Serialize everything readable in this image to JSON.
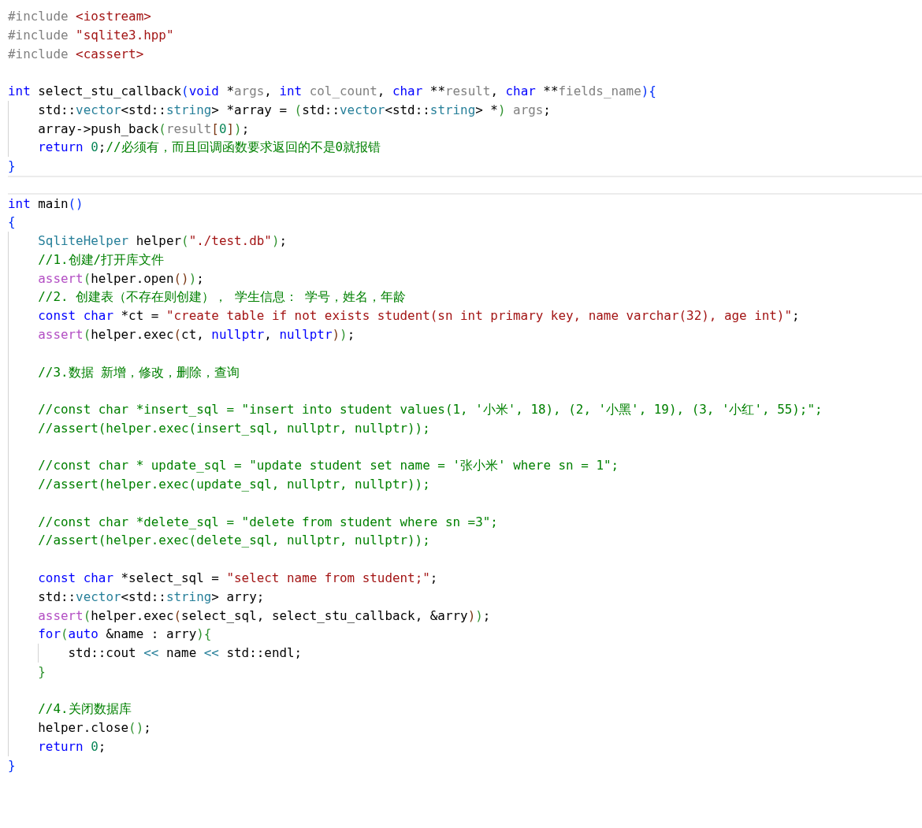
{
  "editor": {
    "lines": [
      {
        "selected": false,
        "tokens": [
          {
            "kind": "pp",
            "text": "#include"
          },
          {
            "kind": "str",
            "text": " <iostream>"
          }
        ]
      },
      {
        "selected": false,
        "tokens": [
          {
            "kind": "pp",
            "text": "#include"
          },
          {
            "kind": "str",
            "text": " \"sqlite3.hpp\""
          }
        ]
      },
      {
        "selected": false,
        "tokens": [
          {
            "kind": "pp",
            "text": "#include"
          },
          {
            "kind": "str",
            "text": " <cassert>"
          }
        ]
      },
      {
        "selected": false
      },
      {
        "selected": false,
        "tokens": [
          {
            "kind": "kw",
            "text": "int"
          },
          {
            "kind": "plain",
            "text": " select_stu_callback"
          },
          {
            "kind": "b1",
            "text": "("
          },
          {
            "kind": "kw",
            "text": "void"
          },
          {
            "kind": "plain",
            "text": " *"
          },
          {
            "kind": "param",
            "text": "args"
          },
          {
            "kind": "plain",
            "text": ", "
          },
          {
            "kind": "kw",
            "text": "int"
          },
          {
            "kind": "param",
            "text": " col_count"
          },
          {
            "kind": "plain",
            "text": ", "
          },
          {
            "kind": "kw",
            "text": "char"
          },
          {
            "kind": "plain",
            "text": " **"
          },
          {
            "kind": "param",
            "text": "result"
          },
          {
            "kind": "plain",
            "text": ", "
          },
          {
            "kind": "kw",
            "text": "char"
          },
          {
            "kind": "plain",
            "text": " **"
          },
          {
            "kind": "param",
            "text": "fields_name"
          },
          {
            "kind": "b1",
            "text": "){"
          }
        ]
      },
      {
        "selected": false,
        "tokens": [
          {
            "kind": "plain",
            "text": "    std::"
          },
          {
            "kind": "type",
            "text": "vector"
          },
          {
            "kind": "plain",
            "text": "<std::"
          },
          {
            "kind": "type",
            "text": "string"
          },
          {
            "kind": "plain",
            "text": "> *array = "
          },
          {
            "kind": "b2",
            "text": "("
          },
          {
            "kind": "plain",
            "text": "std::"
          },
          {
            "kind": "type",
            "text": "vector"
          },
          {
            "kind": "plain",
            "text": "<std::"
          },
          {
            "kind": "type",
            "text": "string"
          },
          {
            "kind": "plain",
            "text": "> *"
          },
          {
            "kind": "b2",
            "text": ")"
          },
          {
            "kind": "param",
            "text": " args"
          },
          {
            "kind": "plain",
            "text": ";"
          }
        ]
      },
      {
        "selected": false,
        "tokens": [
          {
            "kind": "plain",
            "text": "    array->push_back"
          },
          {
            "kind": "b2",
            "text": "("
          },
          {
            "kind": "param",
            "text": "result"
          },
          {
            "kind": "b3",
            "text": "["
          },
          {
            "kind": "num",
            "text": "0"
          },
          {
            "kind": "b3",
            "text": "]"
          },
          {
            "kind": "b2",
            "text": ")"
          },
          {
            "kind": "plain",
            "text": ";"
          }
        ]
      },
      {
        "selected": false,
        "tokens": [
          {
            "kind": "kw",
            "text": "    return"
          },
          {
            "kind": "num",
            "text": " 0"
          },
          {
            "kind": "plain",
            "text": ";"
          },
          {
            "kind": "com",
            "text": "//必须有，而且回调函数要求返回的不是0就报错"
          }
        ]
      },
      {
        "selected": false,
        "tokens": [
          {
            "kind": "b1",
            "text": "}"
          }
        ]
      },
      {
        "selected": true
      },
      {
        "selected": false,
        "tokens": [
          {
            "kind": "kw",
            "text": "int"
          },
          {
            "kind": "plain",
            "text": " main"
          },
          {
            "kind": "b1",
            "text": "()"
          }
        ]
      },
      {
        "selected": false,
        "tokens": [
          {
            "kind": "b1",
            "text": "{"
          }
        ]
      },
      {
        "selected": false,
        "tokens": [
          {
            "kind": "type",
            "text": "    SqliteHelper"
          },
          {
            "kind": "plain",
            "text": " helper"
          },
          {
            "kind": "b2",
            "text": "("
          },
          {
            "kind": "str",
            "text": "\"./test.db\""
          },
          {
            "kind": "b2",
            "text": ")"
          },
          {
            "kind": "plain",
            "text": ";"
          }
        ]
      },
      {
        "selected": false,
        "tokens": [
          {
            "kind": "com",
            "text": "    //1.创建/打开库文件"
          }
        ]
      },
      {
        "selected": false,
        "tokens": [
          {
            "kind": "fn",
            "text": "    assert"
          },
          {
            "kind": "b2",
            "text": "("
          },
          {
            "kind": "plain",
            "text": "helper.open"
          },
          {
            "kind": "b3",
            "text": "()"
          },
          {
            "kind": "b2",
            "text": ")"
          },
          {
            "kind": "plain",
            "text": ";"
          }
        ]
      },
      {
        "selected": false,
        "tokens": [
          {
            "kind": "com",
            "text": "    //2. 创建表（不存在则创建）， 学生信息： 学号，姓名，年龄"
          }
        ]
      },
      {
        "selected": false,
        "tokens": [
          {
            "kind": "kw",
            "text": "    const"
          },
          {
            "kind": "kw",
            "text": " char"
          },
          {
            "kind": "plain",
            "text": " *ct = "
          },
          {
            "kind": "str",
            "text": "\"create table if not exists student(sn int primary key, name varchar(32), age int)\""
          },
          {
            "kind": "plain",
            "text": ";"
          }
        ]
      },
      {
        "selected": false,
        "tokens": [
          {
            "kind": "fn",
            "text": "    assert"
          },
          {
            "kind": "b2",
            "text": "("
          },
          {
            "kind": "plain",
            "text": "helper.exec"
          },
          {
            "kind": "b3",
            "text": "("
          },
          {
            "kind": "plain",
            "text": "ct, "
          },
          {
            "kind": "kw",
            "text": "nullptr"
          },
          {
            "kind": "plain",
            "text": ", "
          },
          {
            "kind": "kw",
            "text": "nullptr"
          },
          {
            "kind": "b3",
            "text": ")"
          },
          {
            "kind": "b2",
            "text": ")"
          },
          {
            "kind": "plain",
            "text": ";"
          }
        ]
      },
      {
        "selected": false
      },
      {
        "selected": false,
        "tokens": [
          {
            "kind": "com",
            "text": "    //3.数据 新增，修改，删除，查询"
          }
        ]
      },
      {
        "selected": false
      },
      {
        "selected": false,
        "tokens": [
          {
            "kind": "com",
            "text": "    //const char *insert_sql = \"insert into student values(1, '小米', 18), (2, '小黑', 19), (3, '小红', 55);\";"
          }
        ]
      },
      {
        "selected": false,
        "tokens": [
          {
            "kind": "com",
            "text": "    //assert(helper.exec(insert_sql, nullptr, nullptr));"
          }
        ]
      },
      {
        "selected": false
      },
      {
        "selected": false,
        "tokens": [
          {
            "kind": "com",
            "text": "    //const char * update_sql = \"update student set name = '张小米' where sn = 1\";"
          }
        ]
      },
      {
        "selected": false,
        "tokens": [
          {
            "kind": "com",
            "text": "    //assert(helper.exec(update_sql, nullptr, nullptr));"
          }
        ]
      },
      {
        "selected": false
      },
      {
        "selected": false,
        "tokens": [
          {
            "kind": "com",
            "text": "    //const char *delete_sql = \"delete from student where sn =3\";"
          }
        ]
      },
      {
        "selected": false,
        "tokens": [
          {
            "kind": "com",
            "text": "    //assert(helper.exec(delete_sql, nullptr, nullptr));"
          }
        ]
      },
      {
        "selected": false
      },
      {
        "selected": false,
        "tokens": [
          {
            "kind": "kw",
            "text": "    const"
          },
          {
            "kind": "kw",
            "text": " char"
          },
          {
            "kind": "plain",
            "text": " *select_sql = "
          },
          {
            "kind": "str",
            "text": "\"select name from student;\""
          },
          {
            "kind": "plain",
            "text": ";"
          }
        ]
      },
      {
        "selected": false,
        "tokens": [
          {
            "kind": "plain",
            "text": "    std::"
          },
          {
            "kind": "type",
            "text": "vector"
          },
          {
            "kind": "plain",
            "text": "<std::"
          },
          {
            "kind": "type",
            "text": "string"
          },
          {
            "kind": "plain",
            "text": "> arry;"
          }
        ]
      },
      {
        "selected": false,
        "tokens": [
          {
            "kind": "fn",
            "text": "    assert"
          },
          {
            "kind": "b2",
            "text": "("
          },
          {
            "kind": "plain",
            "text": "helper.exec"
          },
          {
            "kind": "b3",
            "text": "("
          },
          {
            "kind": "plain",
            "text": "select_sql, select_stu_callback, &arry"
          },
          {
            "kind": "b3",
            "text": ")"
          },
          {
            "kind": "b2",
            "text": ")"
          },
          {
            "kind": "plain",
            "text": ";"
          }
        ]
      },
      {
        "selected": false,
        "tokens": [
          {
            "kind": "kw",
            "text": "    for"
          },
          {
            "kind": "b2",
            "text": "("
          },
          {
            "kind": "kw",
            "text": "auto"
          },
          {
            "kind": "plain",
            "text": " &name : arry"
          },
          {
            "kind": "b2",
            "text": "){"
          }
        ]
      },
      {
        "selected": false,
        "tokens": [
          {
            "kind": "plain",
            "text": "        std::cout "
          },
          {
            "kind": "op",
            "text": "<<"
          },
          {
            "kind": "plain",
            "text": " name "
          },
          {
            "kind": "op",
            "text": "<<"
          },
          {
            "kind": "plain",
            "text": " std::endl;"
          }
        ]
      },
      {
        "selected": false,
        "tokens": [
          {
            "kind": "b2",
            "text": "    }"
          }
        ]
      },
      {
        "selected": false
      },
      {
        "selected": false,
        "tokens": [
          {
            "kind": "com",
            "text": "    //4.关闭数据库"
          }
        ]
      },
      {
        "selected": false,
        "tokens": [
          {
            "kind": "plain",
            "text": "    helper.close"
          },
          {
            "kind": "b2",
            "text": "()"
          },
          {
            "kind": "plain",
            "text": ";"
          }
        ]
      },
      {
        "selected": false,
        "tokens": [
          {
            "kind": "kw",
            "text": "    return"
          },
          {
            "kind": "num",
            "text": " 0"
          },
          {
            "kind": "plain",
            "text": ";"
          }
        ]
      },
      {
        "selected": false,
        "tokens": [
          {
            "kind": "b1",
            "text": "}"
          }
        ]
      }
    ]
  }
}
